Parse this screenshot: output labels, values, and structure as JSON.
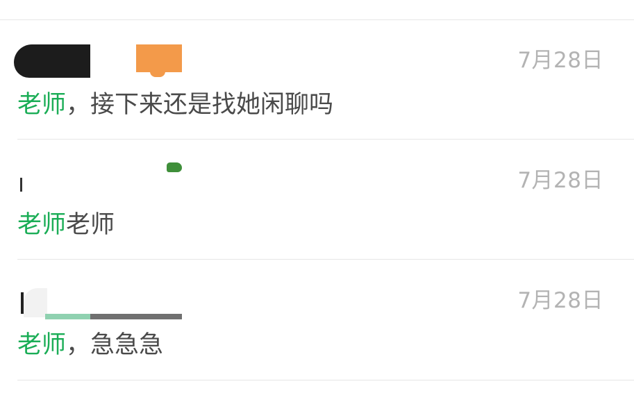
{
  "conversations": [
    {
      "date": "7月28日",
      "sender": "老师",
      "message": "，接下来还是找她闲聊吗"
    },
    {
      "date": "7月28日",
      "sender": "老师",
      "message": "老师"
    },
    {
      "date": "7月28日",
      "sender": "老师",
      "message": "，急急急"
    }
  ],
  "colors": {
    "sender": "#1aad56",
    "message": "#4a4a4a",
    "date": "#b3b3b3",
    "divider": "#e6e6e6"
  }
}
